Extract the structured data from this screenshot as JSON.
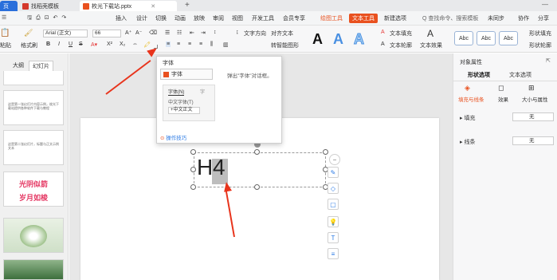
{
  "titlebar": {
    "tabs": [
      {
        "label": "页"
      },
      {
        "label": "找稻壳模板"
      },
      {
        "label": "枚光下载站.pptx"
      }
    ],
    "add_tab": "+"
  },
  "menubar": {
    "items": [
      "三 文件",
      "插入",
      "设计",
      "切换",
      "动画",
      "放映",
      "审阅",
      "视图",
      "开发工具",
      "会员专享"
    ],
    "draw_tool": "绘图工具",
    "text_tool": "文本工具",
    "search": "Q 查找命令、搜索模板",
    "sync": "未同步",
    "collab": "协作",
    "share": "分享",
    "new_tab": "新建选项"
  },
  "toolbar": {
    "font_name": "Arial (正文)",
    "font_size": "66",
    "paste": "粘贴",
    "format_brush": "格式刷",
    "bold": "B",
    "italic": "I",
    "underline": "U",
    "strike": "S",
    "convert": "文字方向",
    "align_text": "对齐文本",
    "smartart": "转智能图形",
    "text_fill": "文本填充",
    "text_outline": "文本轮廓",
    "text_effect": "文本效果",
    "shape_fill": "形状填充",
    "shape_outline": "形状轮廓",
    "abc": [
      "Abc",
      "Abc",
      "Abc"
    ],
    "big_a": [
      "A",
      "A",
      "A"
    ]
  },
  "leftpanel": {
    "tabs": [
      "大纲",
      "幻灯片"
    ],
    "slide_texts": [
      "这是第一张幻灯片内容示例，枚光下载站提供各种软件下载与教程",
      "这是第二张幻灯片，标题与正文示例文本"
    ],
    "slide_title1": "光阴似箭",
    "slide_title2": "岁月如梭"
  },
  "popup": {
    "title": "字体",
    "item": "字体",
    "hint": "弹出\"字体\"对话框。",
    "dlg_tab1": "字体(N)",
    "dlg_tab2": "字",
    "dlg_field1": "中文字体(T)",
    "dlg_field2": "+中文正文",
    "help": "操作技巧"
  },
  "canvas": {
    "text_H": "H",
    "text_4": "4"
  },
  "rightpanel": {
    "title": "对象属性",
    "tabs": [
      "形状选项",
      "文本选项"
    ],
    "subtabs": [
      "填充与线条",
      "效果",
      "大小与属性"
    ],
    "fill_label": "填充",
    "fill_value": "无",
    "line_label": "线条",
    "line_value": "无"
  },
  "colors": {
    "accent": "#e9511f",
    "arrow": "#e8341c",
    "wps_red": "#d4382b",
    "blue": "#2c7be5"
  }
}
